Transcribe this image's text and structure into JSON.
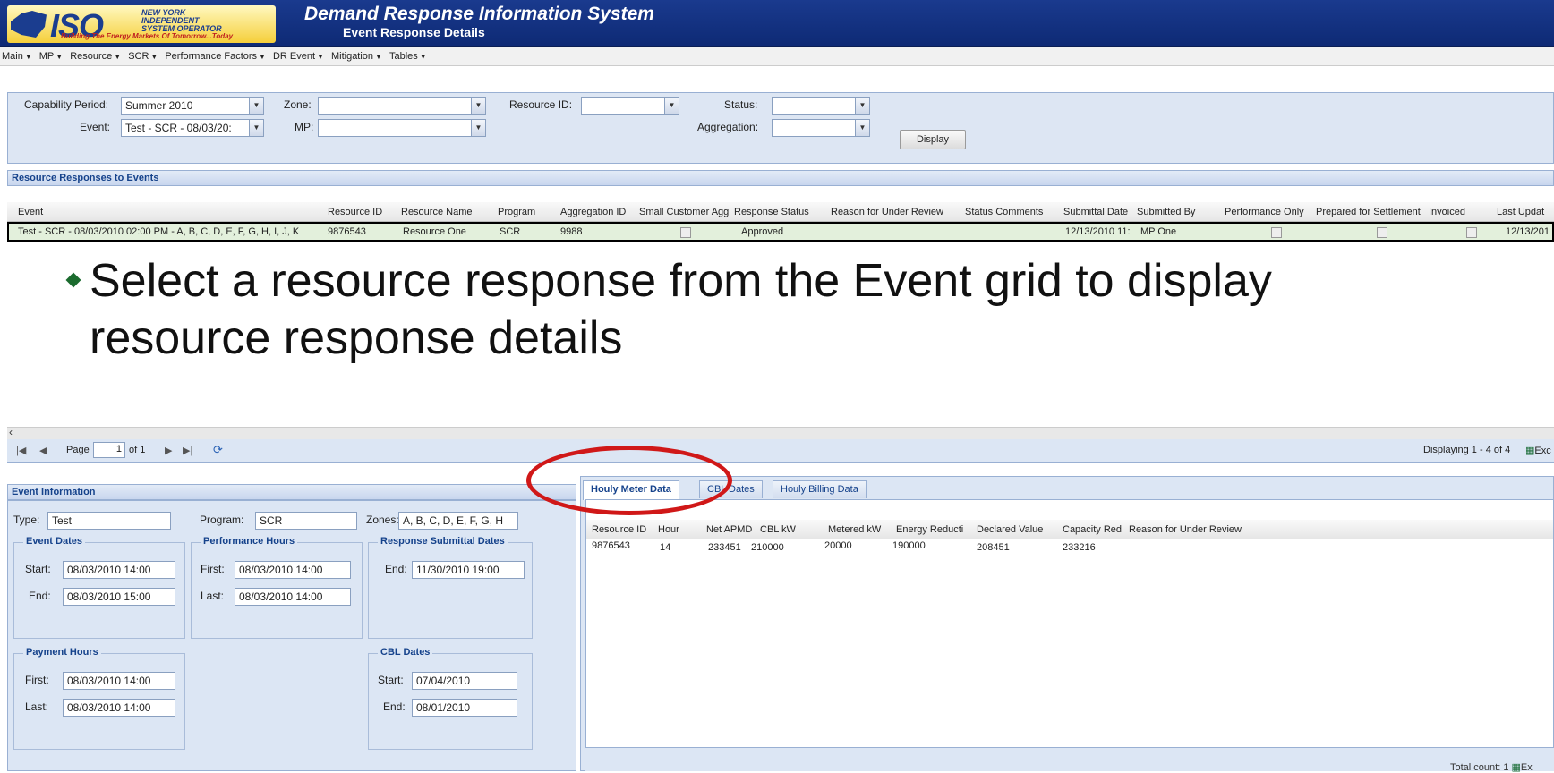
{
  "header": {
    "logo_text": "ISO",
    "logo_sub": "NEW YORK INDEPENDENT SYSTEM OPERATOR",
    "logo_tagline": "Building The Energy Markets Of Tomorrow...Today",
    "app_title": "Demand Response Information System",
    "page_subtitle": "Event Response Details"
  },
  "menu": [
    "Main",
    "MP",
    "Resource",
    "SCR",
    "Performance Factors",
    "DR Event",
    "Mitigation",
    "Tables"
  ],
  "filters": {
    "capability_period_label": "Capability Period:",
    "capability_period_value": "Summer 2010",
    "zone_label": "Zone:",
    "zone_value": "",
    "resource_id_label": "Resource ID:",
    "resource_id_value": "",
    "status_label": "Status:",
    "status_value": "",
    "event_label": "Event:",
    "event_value": "Test - SCR - 08/03/20:",
    "mp_label": "MP:",
    "mp_value": "",
    "aggregation_label": "Aggregation:",
    "aggregation_value": "",
    "display_button": "Display"
  },
  "responses_panel": {
    "title": "Resource Responses to Events",
    "columns": [
      "Event",
      "Resource ID",
      "Resource Name",
      "Program",
      "Aggregation ID",
      "Small Customer Agg",
      "Response Status",
      "Reason for Under Review",
      "Status Comments",
      "Submittal Date",
      "Submitted By",
      "Performance Only",
      "Prepared for Settlement",
      "Invoiced",
      "Last Updat"
    ],
    "row": {
      "event": "Test - SCR - 08/03/2010 02:00 PM - A, B, C, D, E, F, G, H, I, J, K",
      "resource_id": "9876543",
      "resource_name": "Resource One",
      "program": "SCR",
      "aggregation_id": "9988",
      "response_status": "Approved",
      "submittal_date": "12/13/2010 11:",
      "submitted_by": "MP One",
      "last_updated": "12/13/201"
    }
  },
  "bullet": "Select a resource response from the Event grid to display resource response details",
  "pager": {
    "page_label": "Page",
    "page_value": "1",
    "of_label": "of 1",
    "displaying": "Displaying 1 - 4 of 4",
    "export": "Exc"
  },
  "event_info": {
    "title": "Event Information",
    "type_label": "Type:",
    "type_value": "Test",
    "program_label": "Program:",
    "program_value": "SCR",
    "zones_label": "Zones:",
    "zones_value": "A, B, C, D, E, F, G, H",
    "event_dates_legend": "Event Dates",
    "start_label": "Start:",
    "start_value": "08/03/2010 14:00",
    "end_label": "End:",
    "end_value": "08/03/2010 15:00",
    "perf_hours_legend": "Performance Hours",
    "perf_first_label": "First:",
    "perf_first_value": "08/03/2010 14:00",
    "perf_last_label": "Last:",
    "perf_last_value": "08/03/2010 14:00",
    "resp_dates_legend": "Response Submittal Dates",
    "resp_end_label": "End:",
    "resp_end_value": "11/30/2010 19:00",
    "payment_legend": "Payment Hours",
    "pay_first_label": "First:",
    "pay_first_value": "08/03/2010 14:00",
    "pay_last_label": "Last:",
    "pay_last_value": "08/03/2010 14:00",
    "cbl_legend": "CBL Dates",
    "cbl_start_label": "Start:",
    "cbl_start_value": "07/04/2010",
    "cbl_end_label": "End:",
    "cbl_end_value": "08/01/2010"
  },
  "tabs": [
    "Houly Meter Data",
    "CBL Dates",
    "Houly Billing Data"
  ],
  "meter_grid": {
    "columns": [
      "Resource ID",
      "Hour",
      "Net APMD",
      "CBL kW",
      "Metered kW",
      "Energy Reducti",
      "Declared Value",
      "Capacity Red",
      "Reason for Under Review"
    ],
    "row": [
      "9876543",
      "14",
      "233451",
      "210000",
      "20000",
      "190000",
      "208451",
      "233216",
      ""
    ]
  },
  "footer": {
    "total_count": "Total count: 1",
    "export": "Ex"
  },
  "colors": {
    "header_bg": "#1a3a8e",
    "panel_bg": "#dce6f4",
    "panel_title": "#15428b",
    "highlight": "#d01818",
    "selected_row": "#e3f0dc",
    "bullet": "#1b6b2e"
  }
}
